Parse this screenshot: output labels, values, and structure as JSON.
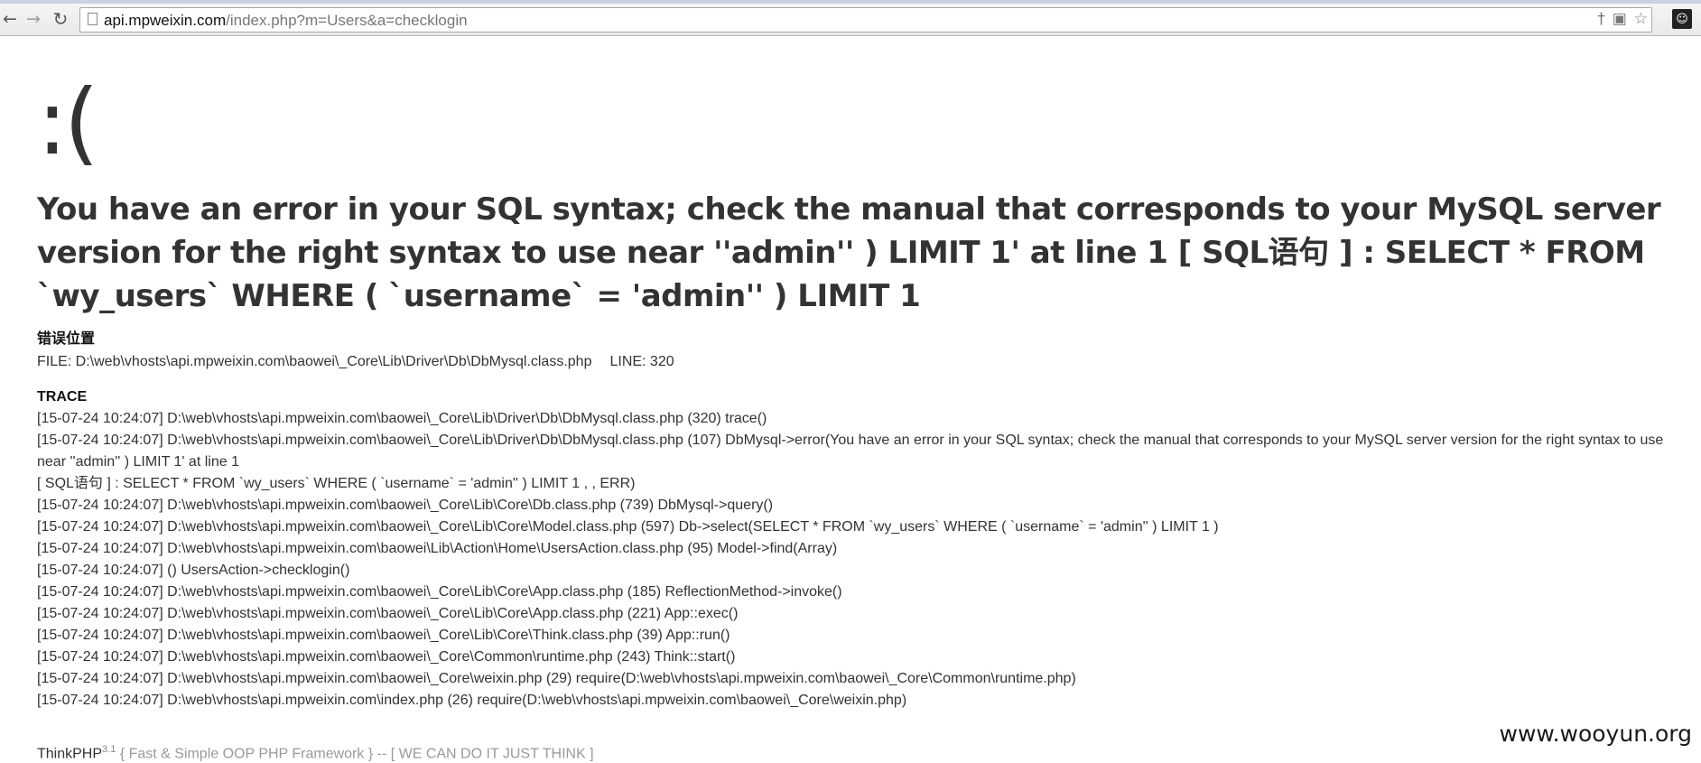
{
  "browser": {
    "url_host": "api.mpweixin.com",
    "url_path": "/index.php?m=Users&a=checklogin",
    "back_icon": "←",
    "forward_icon": "→",
    "reload_icon": "↻",
    "star_icon": "☆",
    "ext_icon": "☺"
  },
  "error": {
    "face": ":(",
    "message": "You have an error in your SQL syntax; check the manual that corresponds to your MySQL server version for the right syntax to use near ''admin'' ) LIMIT 1' at line 1 [ SQL语句 ] : SELECT * FROM `wy_users` WHERE ( `username` = 'admin'' ) LIMIT 1"
  },
  "location": {
    "title": "错误位置",
    "file": "FILE: D:\\web\\vhosts\\api.mpweixin.com\\baowei\\_Core\\Lib\\Driver\\Db\\DbMysql.class.php",
    "line": "LINE: 320"
  },
  "trace": {
    "title": "TRACE",
    "lines": [
      "[15-07-24 10:24:07] D:\\web\\vhosts\\api.mpweixin.com\\baowei\\_Core\\Lib\\Driver\\Db\\DbMysql.class.php (320) trace()",
      "[15-07-24 10:24:07] D:\\web\\vhosts\\api.mpweixin.com\\baowei\\_Core\\Lib\\Driver\\Db\\DbMysql.class.php (107) DbMysql->error(You have an error in your SQL syntax; check the manual that corresponds to your MySQL server version for the right syntax to use near ''admin'' ) LIMIT 1' at line 1",
      "[ SQL语句 ] : SELECT * FROM `wy_users` WHERE ( `username` = 'admin'' ) LIMIT 1 , , ERR)",
      "[15-07-24 10:24:07] D:\\web\\vhosts\\api.mpweixin.com\\baowei\\_Core\\Lib\\Core\\Db.class.php (739) DbMysql->query()",
      "[15-07-24 10:24:07] D:\\web\\vhosts\\api.mpweixin.com\\baowei\\_Core\\Lib\\Core\\Model.class.php (597) Db->select(SELECT * FROM `wy_users` WHERE ( `username` = 'admin'' ) LIMIT 1 )",
      "[15-07-24 10:24:07] D:\\web\\vhosts\\api.mpweixin.com\\baowei\\Lib\\Action\\Home\\UsersAction.class.php (95) Model->find(Array)",
      "[15-07-24 10:24:07] () UsersAction->checklogin()",
      "[15-07-24 10:24:07] D:\\web\\vhosts\\api.mpweixin.com\\baowei\\_Core\\Lib\\Core\\App.class.php (185) ReflectionMethod->invoke()",
      "[15-07-24 10:24:07] D:\\web\\vhosts\\api.mpweixin.com\\baowei\\_Core\\Lib\\Core\\App.class.php (221) App::exec()",
      "[15-07-24 10:24:07] D:\\web\\vhosts\\api.mpweixin.com\\baowei\\_Core\\Lib\\Core\\Think.class.php (39) App::run()",
      "[15-07-24 10:24:07] D:\\web\\vhosts\\api.mpweixin.com\\baowei\\_Core\\Common\\runtime.php (243) Think::start()",
      "[15-07-24 10:24:07] D:\\web\\vhosts\\api.mpweixin.com\\baowei\\_Core\\weixin.php (29) require(D:\\web\\vhosts\\api.mpweixin.com\\baowei\\_Core\\Common\\runtime.php)",
      "[15-07-24 10:24:07] D:\\web\\vhosts\\api.mpweixin.com\\index.php (26) require(D:\\web\\vhosts\\api.mpweixin.com\\baowei\\_Core\\weixin.php)"
    ]
  },
  "footer": {
    "brand": "ThinkPHP",
    "version": "3.1",
    "slogan": " { Fast & Simple OOP PHP Framework } -- [ WE CAN DO IT JUST THINK ]"
  },
  "watermark": "www.wooyun.org"
}
